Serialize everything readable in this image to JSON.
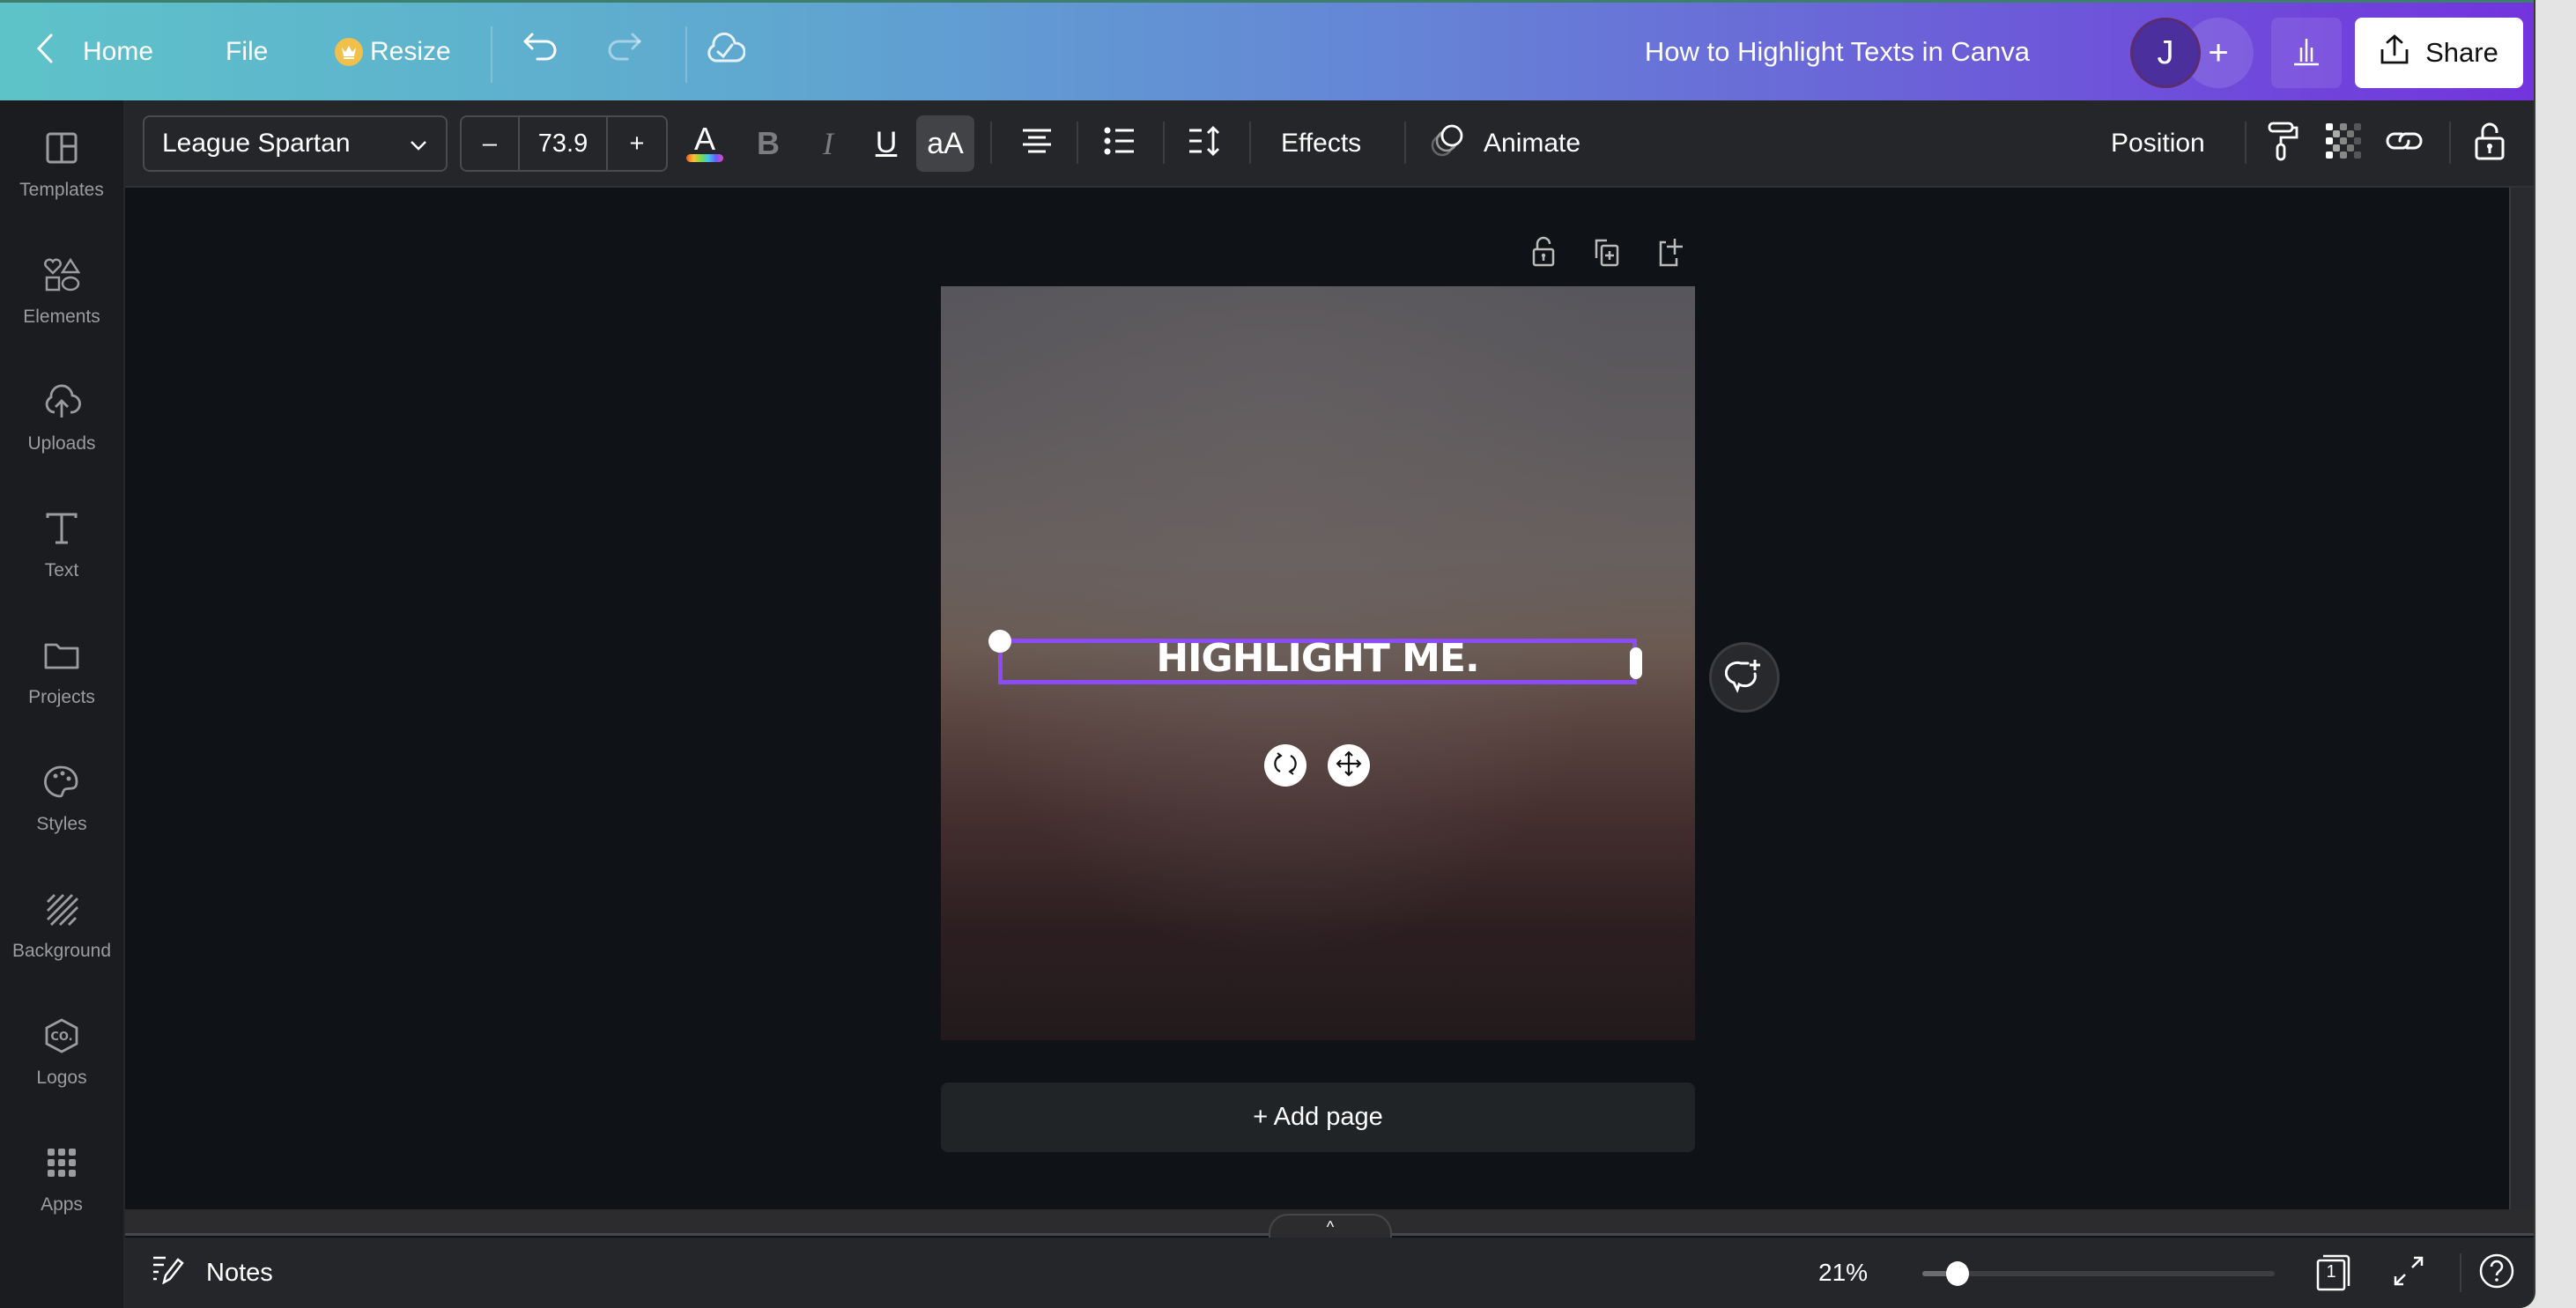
{
  "header": {
    "back_label": "Home",
    "file_label": "File",
    "resize_label": "Resize",
    "design_title": "How to Highlight Texts in Canva",
    "avatar_initial": "J",
    "share_label": "Share",
    "colors": {
      "gradient_start": "#5ec3c9",
      "gradient_end": "#7334dd",
      "resize_crown": "#f1c04b"
    }
  },
  "sidebar": {
    "items": [
      {
        "label": "Templates",
        "icon": "templates-icon"
      },
      {
        "label": "Elements",
        "icon": "elements-icon"
      },
      {
        "label": "Uploads",
        "icon": "upload-cloud-icon"
      },
      {
        "label": "Text",
        "icon": "text-icon"
      },
      {
        "label": "Projects",
        "icon": "folder-icon"
      },
      {
        "label": "Styles",
        "icon": "palette-icon"
      },
      {
        "label": "Background",
        "icon": "background-hatch-icon"
      },
      {
        "label": "Logos",
        "icon": "logo-hexagon-icon"
      },
      {
        "label": "Apps",
        "icon": "apps-grid-icon"
      }
    ]
  },
  "toolbar": {
    "font_family": "League Spartan",
    "font_size": "73.9",
    "minus_label": "–",
    "plus_label": "+",
    "text_color_glyph": "A",
    "bold_glyph": "B",
    "italic_glyph": "I",
    "underline_glyph": "U",
    "case_glyph": "aA",
    "effects_label": "Effects",
    "animate_label": "Animate",
    "position_label": "Position"
  },
  "canvas": {
    "text_element": "HIGHLIGHT ME.",
    "add_page_label": "+ Add page",
    "selection_color": "#8b4cf5"
  },
  "footer": {
    "notes_label": "Notes",
    "zoom_label": "21%",
    "zoom_percent": 21,
    "zoom_slider_fraction": 0.1,
    "page_count": "1",
    "collapse_glyph": "^"
  }
}
